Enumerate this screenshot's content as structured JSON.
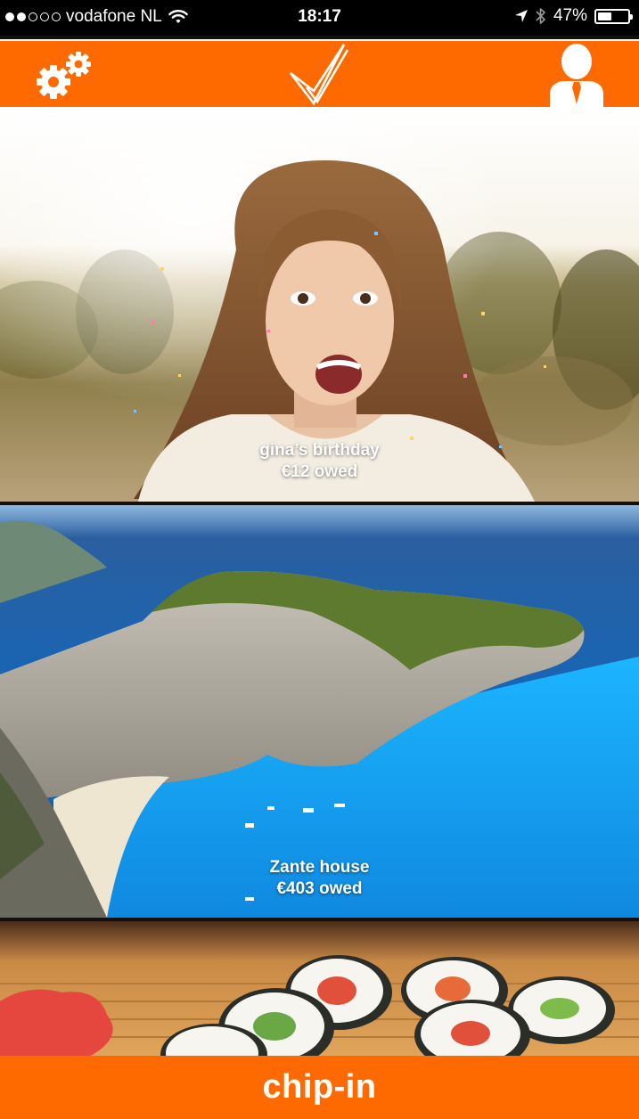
{
  "status_bar": {
    "signal_bars_filled": 2,
    "signal_bars_total": 5,
    "carrier": "vodafone NL",
    "wifi_icon": "wifi-icon",
    "time": "18:17",
    "location_icon": "location-arrow-icon",
    "bluetooth_icon": "bluetooth-icon",
    "battery": "47%",
    "battery_level": 0.47
  },
  "navbar": {
    "background_color": "#ff6a00",
    "left_icon": "settings-gears-icon",
    "center_icon": "double-check-logo-icon",
    "right_icon": "profile-user-icon"
  },
  "feed": [
    {
      "title": "gina’s birthday",
      "amount": "€12 owed"
    },
    {
      "title": "Zante house",
      "amount": "€403 owed"
    },
    {
      "title": "",
      "amount": ""
    }
  ],
  "bottom_bar": {
    "brand": "chip-in",
    "background_color": "#ff6a00"
  }
}
